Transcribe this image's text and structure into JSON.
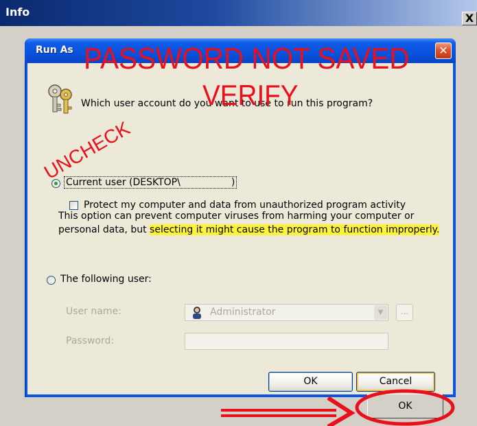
{
  "outer_window": {
    "title": "Info",
    "close_glyph": "X",
    "ok_label": "OK"
  },
  "dialog": {
    "title": "Run As",
    "close_glyph": "✕",
    "question": "Which user account do you want to use to run this program?",
    "current_user": {
      "label": "Current user (DESKTOP\\",
      "suffix": ")",
      "selected": true
    },
    "protect": {
      "label": "Protect my computer and data from unauthorized program activity",
      "checked": false
    },
    "description": {
      "text_plain": "This option can prevent computer viruses from harming your computer or personal data, but ",
      "text_highlighted": "selecting it might cause the program to function improperly."
    },
    "following_user": {
      "label": "The following user:",
      "selected": false
    },
    "user_name": {
      "label": "User name:",
      "value": "Administrator"
    },
    "password": {
      "label": "Password:",
      "value": ""
    },
    "browse_label": "...",
    "ok_label": "OK",
    "cancel_label": "Cancel"
  },
  "annotations": {
    "password_not_saved": "PASSWORD NOT SAVED",
    "verify": "VERIFY",
    "uncheck": "UNCHECK",
    "color": "#e8101c",
    "highlight_color": "#fff536"
  },
  "icons": [
    "keys-icon",
    "user-icon",
    "close-icon",
    "dropdown-arrow-icon"
  ]
}
